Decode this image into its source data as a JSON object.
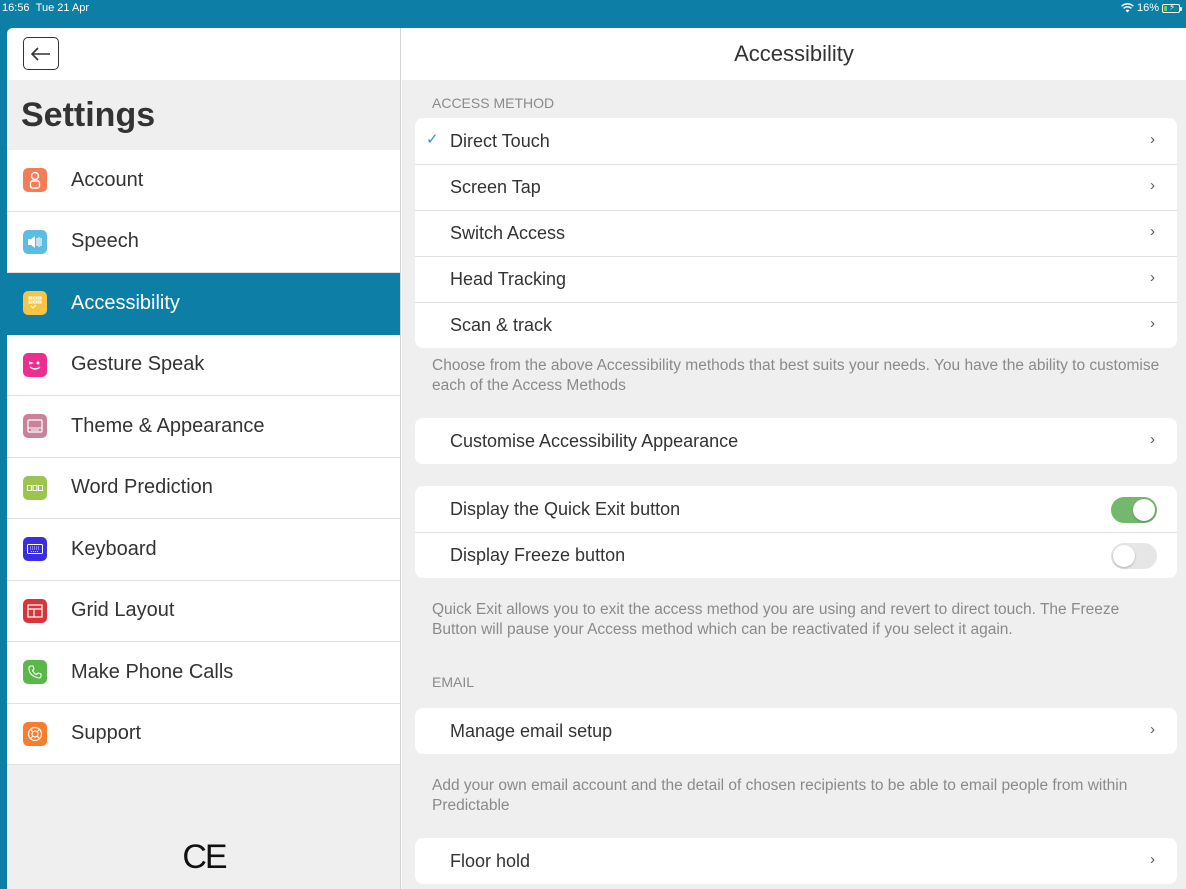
{
  "status_bar": {
    "time": "16:56",
    "date": "Tue 21 Apr",
    "battery": "16%",
    "wifi_icon": "wifi-icon"
  },
  "sidebar": {
    "title": "Settings",
    "back_label": "←",
    "ce_mark": "CE",
    "items": [
      {
        "label": "Account",
        "icon": "person-icon",
        "color": "#f47c56"
      },
      {
        "label": "Speech",
        "icon": "speaker-icon",
        "color": "#5bbce4"
      },
      {
        "label": "Accessibility",
        "icon": "grid-dots-icon",
        "color": "#f7c543",
        "active": true
      },
      {
        "label": "Gesture Speak",
        "icon": "wink-face-icon",
        "color": "#ec2f8f"
      },
      {
        "label": "Theme & Appearance",
        "icon": "window-icon",
        "color": "#c9829a"
      },
      {
        "label": "Word Prediction",
        "icon": "prediction-bar-icon",
        "color": "#9bc54e"
      },
      {
        "label": "Keyboard",
        "icon": "keyboard-icon",
        "color": "#3b2ee0"
      },
      {
        "label": "Grid Layout",
        "icon": "grid-layout-icon",
        "color": "#d8343b"
      },
      {
        "label": "Make Phone Calls",
        "icon": "phone-icon",
        "color": "#5ab84b"
      },
      {
        "label": "Support",
        "icon": "lifebuoy-icon",
        "color": "#f97d2e"
      }
    ]
  },
  "main": {
    "title": "Accessibility",
    "access_method": {
      "label": "ACCESS METHOD",
      "items": [
        {
          "label": "Direct Touch",
          "checked": true
        },
        {
          "label": "Screen Tap"
        },
        {
          "label": "Switch Access"
        },
        {
          "label": "Head Tracking"
        },
        {
          "label": "Scan & track"
        }
      ],
      "note": "Choose from the above Accessibility methods that best suits your needs. You have the ability to customise each of the Access Methods"
    },
    "customise": {
      "label": "Customise Accessibility Appearance"
    },
    "toggles": [
      {
        "label": "Display the Quick Exit button",
        "on": true
      },
      {
        "label": "Display Freeze button",
        "on": false
      }
    ],
    "toggles_note": "Quick Exit allows you to exit the access method you are using and revert to direct touch. The Freeze Button will pause your Access method which can be reactivated if you select it again.",
    "email": {
      "label": "EMAIL",
      "item": "Manage email setup",
      "note": "Add your own email account and the detail of chosen recipients to be able to email people from within Predictable"
    },
    "floor_hold": {
      "label": "Floor hold"
    }
  }
}
